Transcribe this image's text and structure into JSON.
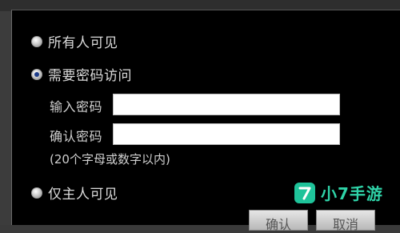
{
  "visibility": {
    "options": [
      {
        "label": "所有人可见",
        "checked": false
      },
      {
        "label": "需要密码访问",
        "checked": true
      },
      {
        "label": "仅主人可见",
        "checked": false
      }
    ],
    "password_label": "输入密码",
    "password_value": "",
    "confirm_label": "确认密码",
    "confirm_value": "",
    "hint": "(20个字母或数字以内)"
  },
  "buttons": {
    "ok_label": "确认",
    "cancel_label": "取消"
  },
  "watermark": {
    "text": "小7手游"
  },
  "colors": {
    "dialog_background": "#000000",
    "radio_selected": "#1e3d8a",
    "watermark": "#1fc39a"
  }
}
